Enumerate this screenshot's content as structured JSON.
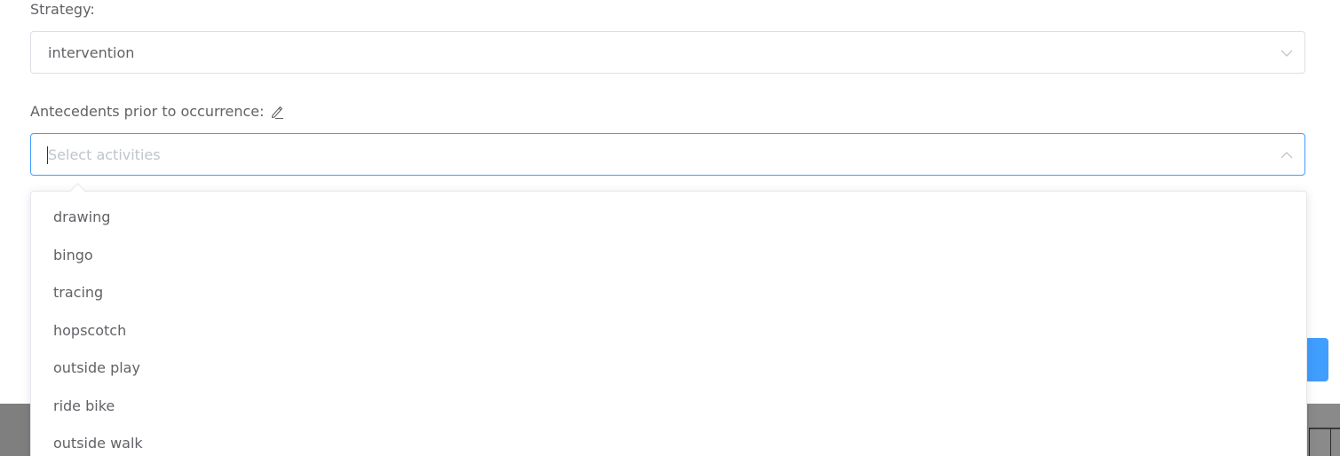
{
  "form": {
    "strategy": {
      "label": "Strategy:",
      "value": "intervention",
      "arrow_icon": "chevron-down-icon"
    },
    "antecedents": {
      "label": "Antecedents prior to occurrence:",
      "label_icon": "pencil-icon",
      "placeholder": "Select activities",
      "arrow_icon": "chevron-up-icon",
      "focused": true
    }
  },
  "dropdown": {
    "options": [
      "drawing",
      "bingo",
      "tracing",
      "hopscotch",
      "outside play",
      "ride bike",
      "outside walk"
    ]
  },
  "colors": {
    "accent": "#409eff",
    "text": "#606266",
    "placeholder": "#c0c4cc",
    "border": "#dcdfe6",
    "backdrop": "#7f7f7f"
  }
}
